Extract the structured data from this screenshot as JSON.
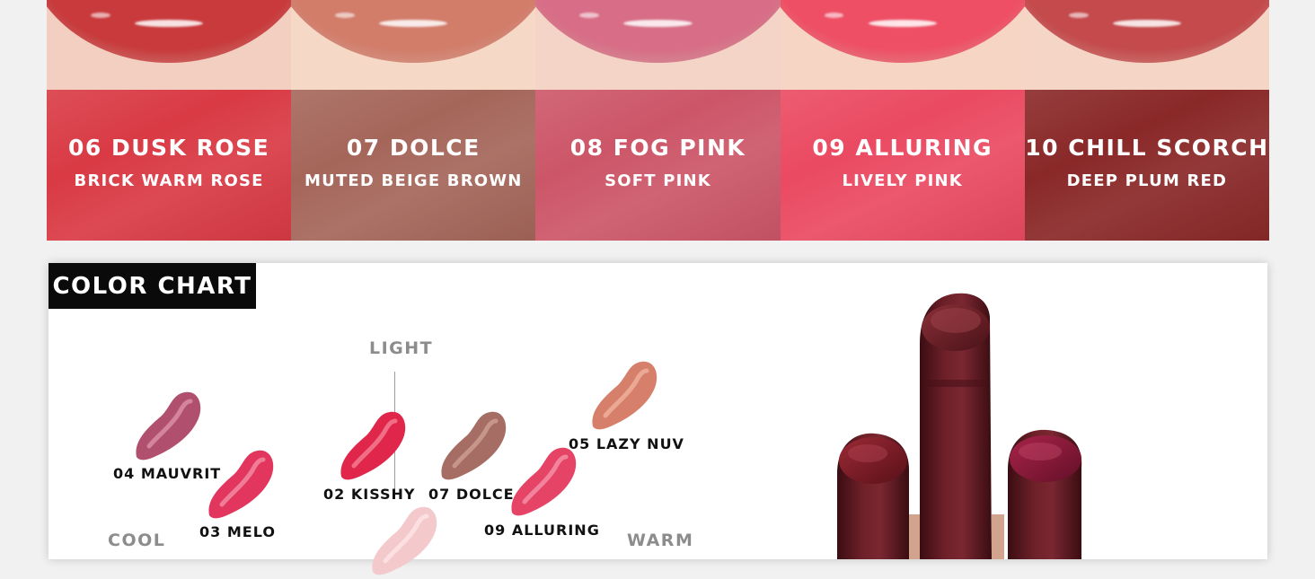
{
  "shades": [
    {
      "number_name": "06 DUSK ROSE",
      "description": "BRICK WARM ROSE",
      "color": "#d93a44",
      "lip": "#c83a3c",
      "skin": "#f2cfc0"
    },
    {
      "number_name": "07 DOLCE",
      "description": "MUTED BEIGE BROWN",
      "color": "#a5665a",
      "lip": "#d27c6a",
      "skin": "#f6d8c6"
    },
    {
      "number_name": "08 FOG PINK",
      "description": "SOFT PINK",
      "color": "#cc5668",
      "lip": "#d76d86",
      "skin": "#f3d4c6"
    },
    {
      "number_name": "09 ALLURING",
      "description": "LIVELY PINK",
      "color": "#ea4a62",
      "lip": "#ee4f65",
      "skin": "#f7d5c5"
    },
    {
      "number_name": "10 CHILL SCORCH",
      "description": "DEEP PLUM RED",
      "color": "#8a2828",
      "lip": "#c44a4c",
      "skin": "#f5d6c6"
    }
  ],
  "color_chart": {
    "title": "COLOR CHART",
    "axis": {
      "light": "LIGHT",
      "cool": "COOL",
      "warm": "WARM"
    },
    "swatches": [
      {
        "label": "04 MAUVRIT",
        "color": "#b0506e",
        "highlight": "#e39ab3"
      },
      {
        "label": "03 MELO",
        "color": "#e2365e",
        "highlight": "#f79bb0"
      },
      {
        "label": "02 KISSHY",
        "color": "#e0264a",
        "highlight": "#f78da0"
      },
      {
        "label": "07 DOLCE",
        "color": "#a56d63",
        "highlight": "#d4a79d"
      },
      {
        "label": "09 ALLURING",
        "color": "#e54467",
        "highlight": "#f7a0b4"
      },
      {
        "label": "05 LAZY NUV",
        "color": "#d6806c",
        "highlight": "#f2b9a7"
      },
      {
        "label": "",
        "color": "#f3c9cc",
        "highlight": "#fde8ea"
      }
    ],
    "lipstick": {
      "body_color": "#5e1a22",
      "bullet_center": "#6b1d26",
      "bullet_left": "#7c1d29",
      "bullet_right": "#8a1634",
      "gold": "#c9a08a"
    }
  }
}
